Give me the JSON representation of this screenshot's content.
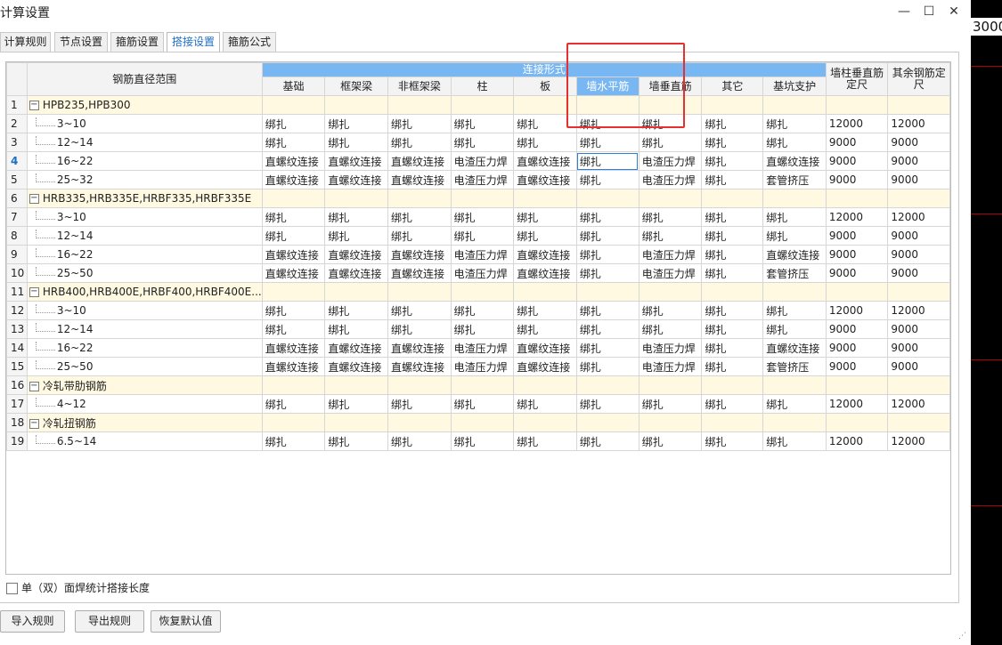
{
  "window": {
    "title": "计算设置",
    "minimize": "—",
    "maximize": "☐",
    "close": "✕"
  },
  "tabs": [
    {
      "label": "计算规则"
    },
    {
      "label": "节点设置"
    },
    {
      "label": "箍筋设置"
    },
    {
      "label": "搭接设置",
      "active": true
    },
    {
      "label": "箍筋公式"
    }
  ],
  "background_app": {
    "number": "3000"
  },
  "grid": {
    "range_header": "钢筋直径范围",
    "group_header": "连接形式",
    "columns": [
      "基础",
      "框架梁",
      "非框架梁",
      "柱",
      "板",
      "墙水平筋",
      "墙垂直筋",
      "其它",
      "基坑支护"
    ],
    "col_wall_col": "墙柱垂直筋定尺",
    "col_other": "其余钢筋定尺",
    "rows": [
      {
        "n": "1",
        "group": true,
        "range": "HPB235,HPB300"
      },
      {
        "n": "2",
        "range": "3~10",
        "vals": [
          "绑扎",
          "绑扎",
          "绑扎",
          "绑扎",
          "绑扎",
          "绑扎",
          "绑扎",
          "绑扎",
          "绑扎",
          "12000",
          "12000"
        ]
      },
      {
        "n": "3",
        "range": "12~14",
        "vals": [
          "绑扎",
          "绑扎",
          "绑扎",
          "绑扎",
          "绑扎",
          "绑扎",
          "绑扎",
          "绑扎",
          "绑扎",
          "9000",
          "9000"
        ]
      },
      {
        "n": "4",
        "range": "16~22",
        "current": true,
        "vals": [
          "直螺纹连接",
          "直螺纹连接",
          "直螺纹连接",
          "电渣压力焊",
          "直螺纹连接",
          "绑扎",
          "电渣压力焊",
          "绑扎",
          "直螺纹连接",
          "9000",
          "9000"
        ]
      },
      {
        "n": "5",
        "range": "25~32",
        "vals": [
          "直螺纹连接",
          "直螺纹连接",
          "直螺纹连接",
          "电渣压力焊",
          "直螺纹连接",
          "绑扎",
          "电渣压力焊",
          "绑扎",
          "套管挤压",
          "9000",
          "9000"
        ]
      },
      {
        "n": "6",
        "group": true,
        "range": "HRB335,HRB335E,HRBF335,HRBF335E"
      },
      {
        "n": "7",
        "range": "3~10",
        "vals": [
          "绑扎",
          "绑扎",
          "绑扎",
          "绑扎",
          "绑扎",
          "绑扎",
          "绑扎",
          "绑扎",
          "绑扎",
          "12000",
          "12000"
        ]
      },
      {
        "n": "8",
        "range": "12~14",
        "vals": [
          "绑扎",
          "绑扎",
          "绑扎",
          "绑扎",
          "绑扎",
          "绑扎",
          "绑扎",
          "绑扎",
          "绑扎",
          "9000",
          "9000"
        ]
      },
      {
        "n": "9",
        "range": "16~22",
        "vals": [
          "直螺纹连接",
          "直螺纹连接",
          "直螺纹连接",
          "电渣压力焊",
          "直螺纹连接",
          "绑扎",
          "电渣压力焊",
          "绑扎",
          "直螺纹连接",
          "9000",
          "9000"
        ]
      },
      {
        "n": "10",
        "range": "25~50",
        "vals": [
          "直螺纹连接",
          "直螺纹连接",
          "直螺纹连接",
          "电渣压力焊",
          "直螺纹连接",
          "绑扎",
          "电渣压力焊",
          "绑扎",
          "套管挤压",
          "9000",
          "9000"
        ]
      },
      {
        "n": "11",
        "group": true,
        "range": "HRB400,HRB400E,HRBF400,HRBF400E..."
      },
      {
        "n": "12",
        "range": "3~10",
        "vals": [
          "绑扎",
          "绑扎",
          "绑扎",
          "绑扎",
          "绑扎",
          "绑扎",
          "绑扎",
          "绑扎",
          "绑扎",
          "12000",
          "12000"
        ]
      },
      {
        "n": "13",
        "range": "12~14",
        "vals": [
          "绑扎",
          "绑扎",
          "绑扎",
          "绑扎",
          "绑扎",
          "绑扎",
          "绑扎",
          "绑扎",
          "绑扎",
          "9000",
          "9000"
        ]
      },
      {
        "n": "14",
        "range": "16~22",
        "vals": [
          "直螺纹连接",
          "直螺纹连接",
          "直螺纹连接",
          "电渣压力焊",
          "直螺纹连接",
          "绑扎",
          "电渣压力焊",
          "绑扎",
          "直螺纹连接",
          "9000",
          "9000"
        ]
      },
      {
        "n": "15",
        "range": "25~50",
        "vals": [
          "直螺纹连接",
          "直螺纹连接",
          "直螺纹连接",
          "电渣压力焊",
          "直螺纹连接",
          "绑扎",
          "电渣压力焊",
          "绑扎",
          "套管挤压",
          "9000",
          "9000"
        ]
      },
      {
        "n": "16",
        "group": true,
        "range": "冷轧带肋钢筋"
      },
      {
        "n": "17",
        "range": "4~12",
        "vals": [
          "绑扎",
          "绑扎",
          "绑扎",
          "绑扎",
          "绑扎",
          "绑扎",
          "绑扎",
          "绑扎",
          "绑扎",
          "12000",
          "12000"
        ]
      },
      {
        "n": "18",
        "group": true,
        "range": "冷轧扭钢筋"
      },
      {
        "n": "19",
        "range": "6.5~14",
        "vals": [
          "绑扎",
          "绑扎",
          "绑扎",
          "绑扎",
          "绑扎",
          "绑扎",
          "绑扎",
          "绑扎",
          "绑扎",
          "12000",
          "12000"
        ]
      }
    ]
  },
  "checkbox": {
    "label": "单（双）面焊统计搭接长度",
    "checked": false
  },
  "buttons": {
    "import": "导入规则",
    "export": "导出规则",
    "restore": "恢复默认值"
  },
  "colors": {
    "header_accent": "#79b7f2",
    "group_row": "#fff9e1",
    "annotation": "#e53030",
    "active_tab": "#1f6fc5"
  }
}
